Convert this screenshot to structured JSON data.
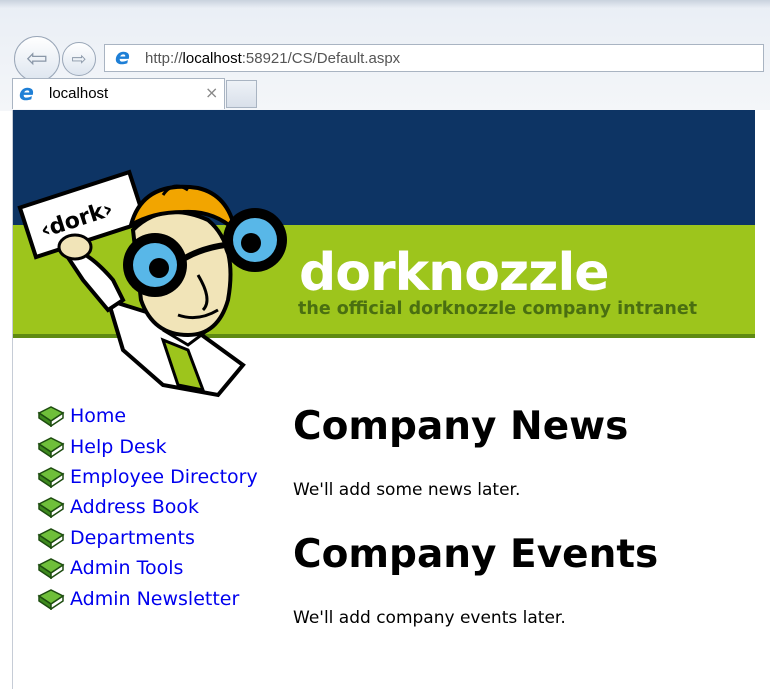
{
  "browser": {
    "address_prefix": "http://",
    "address_host": "localhost",
    "address_rest": ":58921/CS/Default.aspx",
    "tab_title": "localhost",
    "tab_close": "×"
  },
  "banner": {
    "sign_text": "‹dork›",
    "title": "dorknozzle",
    "tagline": "the official dorknozzle company intranet"
  },
  "menu": {
    "items": [
      {
        "label": "Home"
      },
      {
        "label": "Help Desk"
      },
      {
        "label": "Employee Directory"
      },
      {
        "label": "Address Book"
      },
      {
        "label": "Departments"
      },
      {
        "label": "Admin Tools"
      },
      {
        "label": "Admin Newsletter"
      }
    ]
  },
  "content": {
    "news_heading": "Company News",
    "news_text": "We'll add some news later.",
    "events_heading": "Company Events",
    "events_text": "We'll add company events later."
  },
  "colors": {
    "banner_navy": "#0d3464",
    "banner_green": "#9dc51c",
    "link": "#0000ee"
  }
}
